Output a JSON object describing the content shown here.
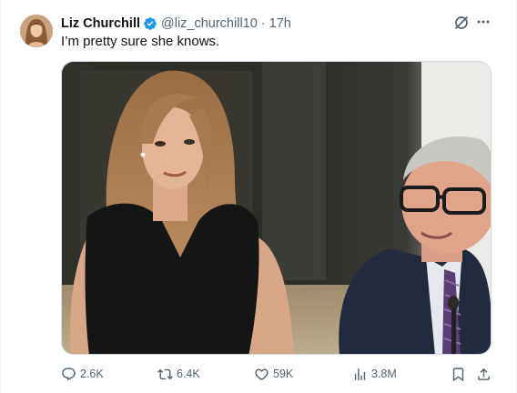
{
  "author": {
    "display_name": "Liz Churchill",
    "handle": "@liz_churchill10",
    "separator": "·",
    "time": "17h",
    "verified": true
  },
  "tweet": {
    "text": "I’m pretty sure she knows."
  },
  "icons": {
    "verified": "verified-badge-icon",
    "grok": "grok-icon",
    "more": "more-icon",
    "reply": "reply-icon",
    "retweet": "retweet-icon",
    "like": "heart-icon",
    "views": "views-icon",
    "bookmark": "bookmark-icon",
    "share": "share-icon"
  },
  "actions": {
    "replies": "2.6K",
    "retweets": "6.4K",
    "likes": "59K",
    "views": "3.8M"
  },
  "colors": {
    "verified_blue": "#1d9bf0",
    "secondary_text": "#536471",
    "primary_text": "#0f1419"
  }
}
